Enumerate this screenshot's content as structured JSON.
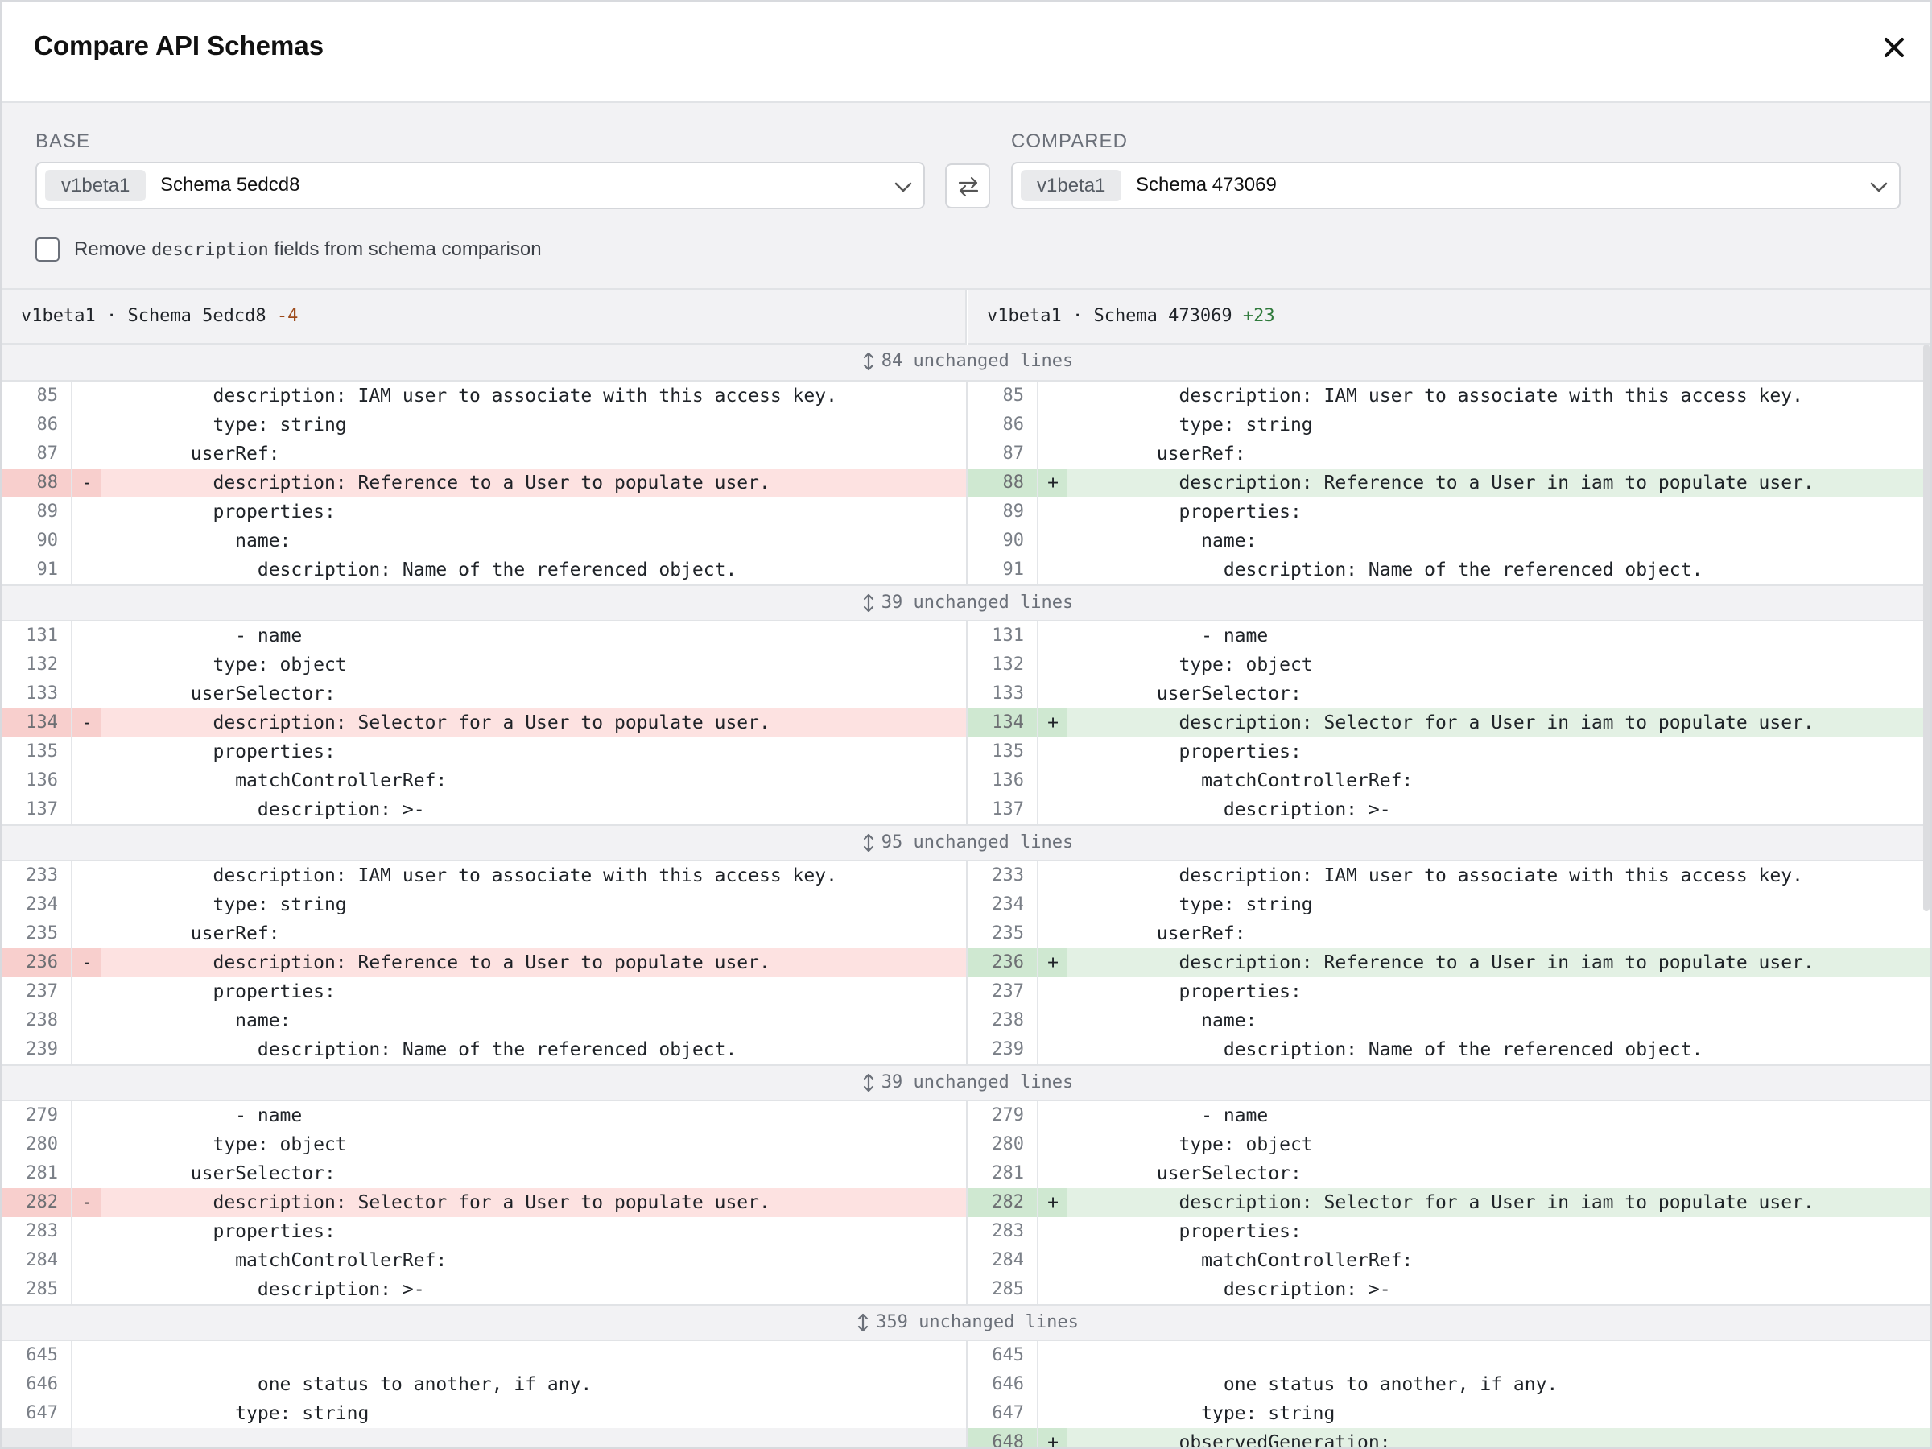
{
  "header": {
    "title": "Compare API Schemas"
  },
  "base": {
    "label": "BASE",
    "chip": "v1beta1",
    "value": "Schema 5edcd8"
  },
  "compared": {
    "label": "COMPARED",
    "chip": "v1beta1",
    "value": "Schema 473069"
  },
  "option": {
    "prefix": "Remove ",
    "code": "description",
    "suffix": " fields from schema comparison",
    "checked": false
  },
  "left_file": {
    "name": "v1beta1 · Schema 5edcd8",
    "count": "-4"
  },
  "right_file": {
    "name": "v1beta1 · Schema 473069",
    "count": "+23"
  },
  "diff": [
    {
      "type": "hunk",
      "text": "84 unchanged lines"
    },
    {
      "type": "row",
      "l": "85",
      "r": "85",
      "lc": "          description: IAM user to associate with this access key.",
      "rc": "          description: IAM user to associate with this access key."
    },
    {
      "type": "row",
      "l": "86",
      "r": "86",
      "lc": "          type: string",
      "rc": "          type: string"
    },
    {
      "type": "row",
      "l": "87",
      "r": "87",
      "lc": "        userRef:",
      "rc": "        userRef:"
    },
    {
      "type": "row",
      "l": "88",
      "r": "88",
      "lm": "-",
      "rm": "+",
      "ls": "del",
      "rs": "add",
      "lc": "          description: Reference to a User to populate user.",
      "rc": "          description: Reference to a User in iam to populate user."
    },
    {
      "type": "row",
      "l": "89",
      "r": "89",
      "lc": "          properties:",
      "rc": "          properties:"
    },
    {
      "type": "row",
      "l": "90",
      "r": "90",
      "lc": "            name:",
      "rc": "            name:"
    },
    {
      "type": "row",
      "l": "91",
      "r": "91",
      "lc": "              description: Name of the referenced object.",
      "rc": "              description: Name of the referenced object."
    },
    {
      "type": "hunk",
      "text": "39 unchanged lines"
    },
    {
      "type": "row",
      "l": "131",
      "r": "131",
      "lc": "            - name",
      "rc": "            - name"
    },
    {
      "type": "row",
      "l": "132",
      "r": "132",
      "lc": "          type: object",
      "rc": "          type: object"
    },
    {
      "type": "row",
      "l": "133",
      "r": "133",
      "lc": "        userSelector:",
      "rc": "        userSelector:"
    },
    {
      "type": "row",
      "l": "134",
      "r": "134",
      "lm": "-",
      "rm": "+",
      "ls": "del",
      "rs": "add",
      "lc": "          description: Selector for a User to populate user.",
      "rc": "          description: Selector for a User in iam to populate user."
    },
    {
      "type": "row",
      "l": "135",
      "r": "135",
      "lc": "          properties:",
      "rc": "          properties:"
    },
    {
      "type": "row",
      "l": "136",
      "r": "136",
      "lc": "            matchControllerRef:",
      "rc": "            matchControllerRef:"
    },
    {
      "type": "row",
      "l": "137",
      "r": "137",
      "lc": "              description: >-",
      "rc": "              description: >-"
    },
    {
      "type": "hunk",
      "text": "95 unchanged lines"
    },
    {
      "type": "row",
      "l": "233",
      "r": "233",
      "lc": "          description: IAM user to associate with this access key.",
      "rc": "          description: IAM user to associate with this access key."
    },
    {
      "type": "row",
      "l": "234",
      "r": "234",
      "lc": "          type: string",
      "rc": "          type: string"
    },
    {
      "type": "row",
      "l": "235",
      "r": "235",
      "lc": "        userRef:",
      "rc": "        userRef:"
    },
    {
      "type": "row",
      "l": "236",
      "r": "236",
      "lm": "-",
      "rm": "+",
      "ls": "del",
      "rs": "add",
      "lc": "          description: Reference to a User to populate user.",
      "rc": "          description: Reference to a User in iam to populate user."
    },
    {
      "type": "row",
      "l": "237",
      "r": "237",
      "lc": "          properties:",
      "rc": "          properties:"
    },
    {
      "type": "row",
      "l": "238",
      "r": "238",
      "lc": "            name:",
      "rc": "            name:"
    },
    {
      "type": "row",
      "l": "239",
      "r": "239",
      "lc": "              description: Name of the referenced object.",
      "rc": "              description: Name of the referenced object."
    },
    {
      "type": "hunk",
      "text": "39 unchanged lines"
    },
    {
      "type": "row",
      "l": "279",
      "r": "279",
      "lc": "            - name",
      "rc": "            - name"
    },
    {
      "type": "row",
      "l": "280",
      "r": "280",
      "lc": "          type: object",
      "rc": "          type: object"
    },
    {
      "type": "row",
      "l": "281",
      "r": "281",
      "lc": "        userSelector:",
      "rc": "        userSelector:"
    },
    {
      "type": "row",
      "l": "282",
      "r": "282",
      "lm": "-",
      "rm": "+",
      "ls": "del",
      "rs": "add",
      "lc": "          description: Selector for a User to populate user.",
      "rc": "          description: Selector for a User in iam to populate user."
    },
    {
      "type": "row",
      "l": "283",
      "r": "283",
      "lc": "          properties:",
      "rc": "          properties:"
    },
    {
      "type": "row",
      "l": "284",
      "r": "284",
      "lc": "            matchControllerRef:",
      "rc": "            matchControllerRef:"
    },
    {
      "type": "row",
      "l": "285",
      "r": "285",
      "lc": "              description: >-",
      "rc": "              description: >-"
    },
    {
      "type": "hunk",
      "text": "359 unchanged lines"
    },
    {
      "type": "row",
      "l": "645",
      "r": "645",
      "lc": "",
      "rc": ""
    },
    {
      "type": "row",
      "l": "646",
      "r": "646",
      "lc": "              one status to another, if any.",
      "rc": "              one status to another, if any."
    },
    {
      "type": "row",
      "l": "647",
      "r": "647",
      "lc": "            type: string",
      "rc": "            type: string"
    },
    {
      "type": "row",
      "l": "",
      "r": "648",
      "rm": "+",
      "ls": "empty",
      "rs": "add",
      "lc": "",
      "rc": "          observedGeneration:"
    }
  ],
  "colors": {
    "deletion": "#fde2e1",
    "addition": "#e3f1e4",
    "hunk": "#f2f2f4"
  },
  "icons": {
    "close": "close-icon",
    "chevron": "chevron-down-icon",
    "swap": "swap-icon",
    "expand": "expand-vertical-icon"
  }
}
